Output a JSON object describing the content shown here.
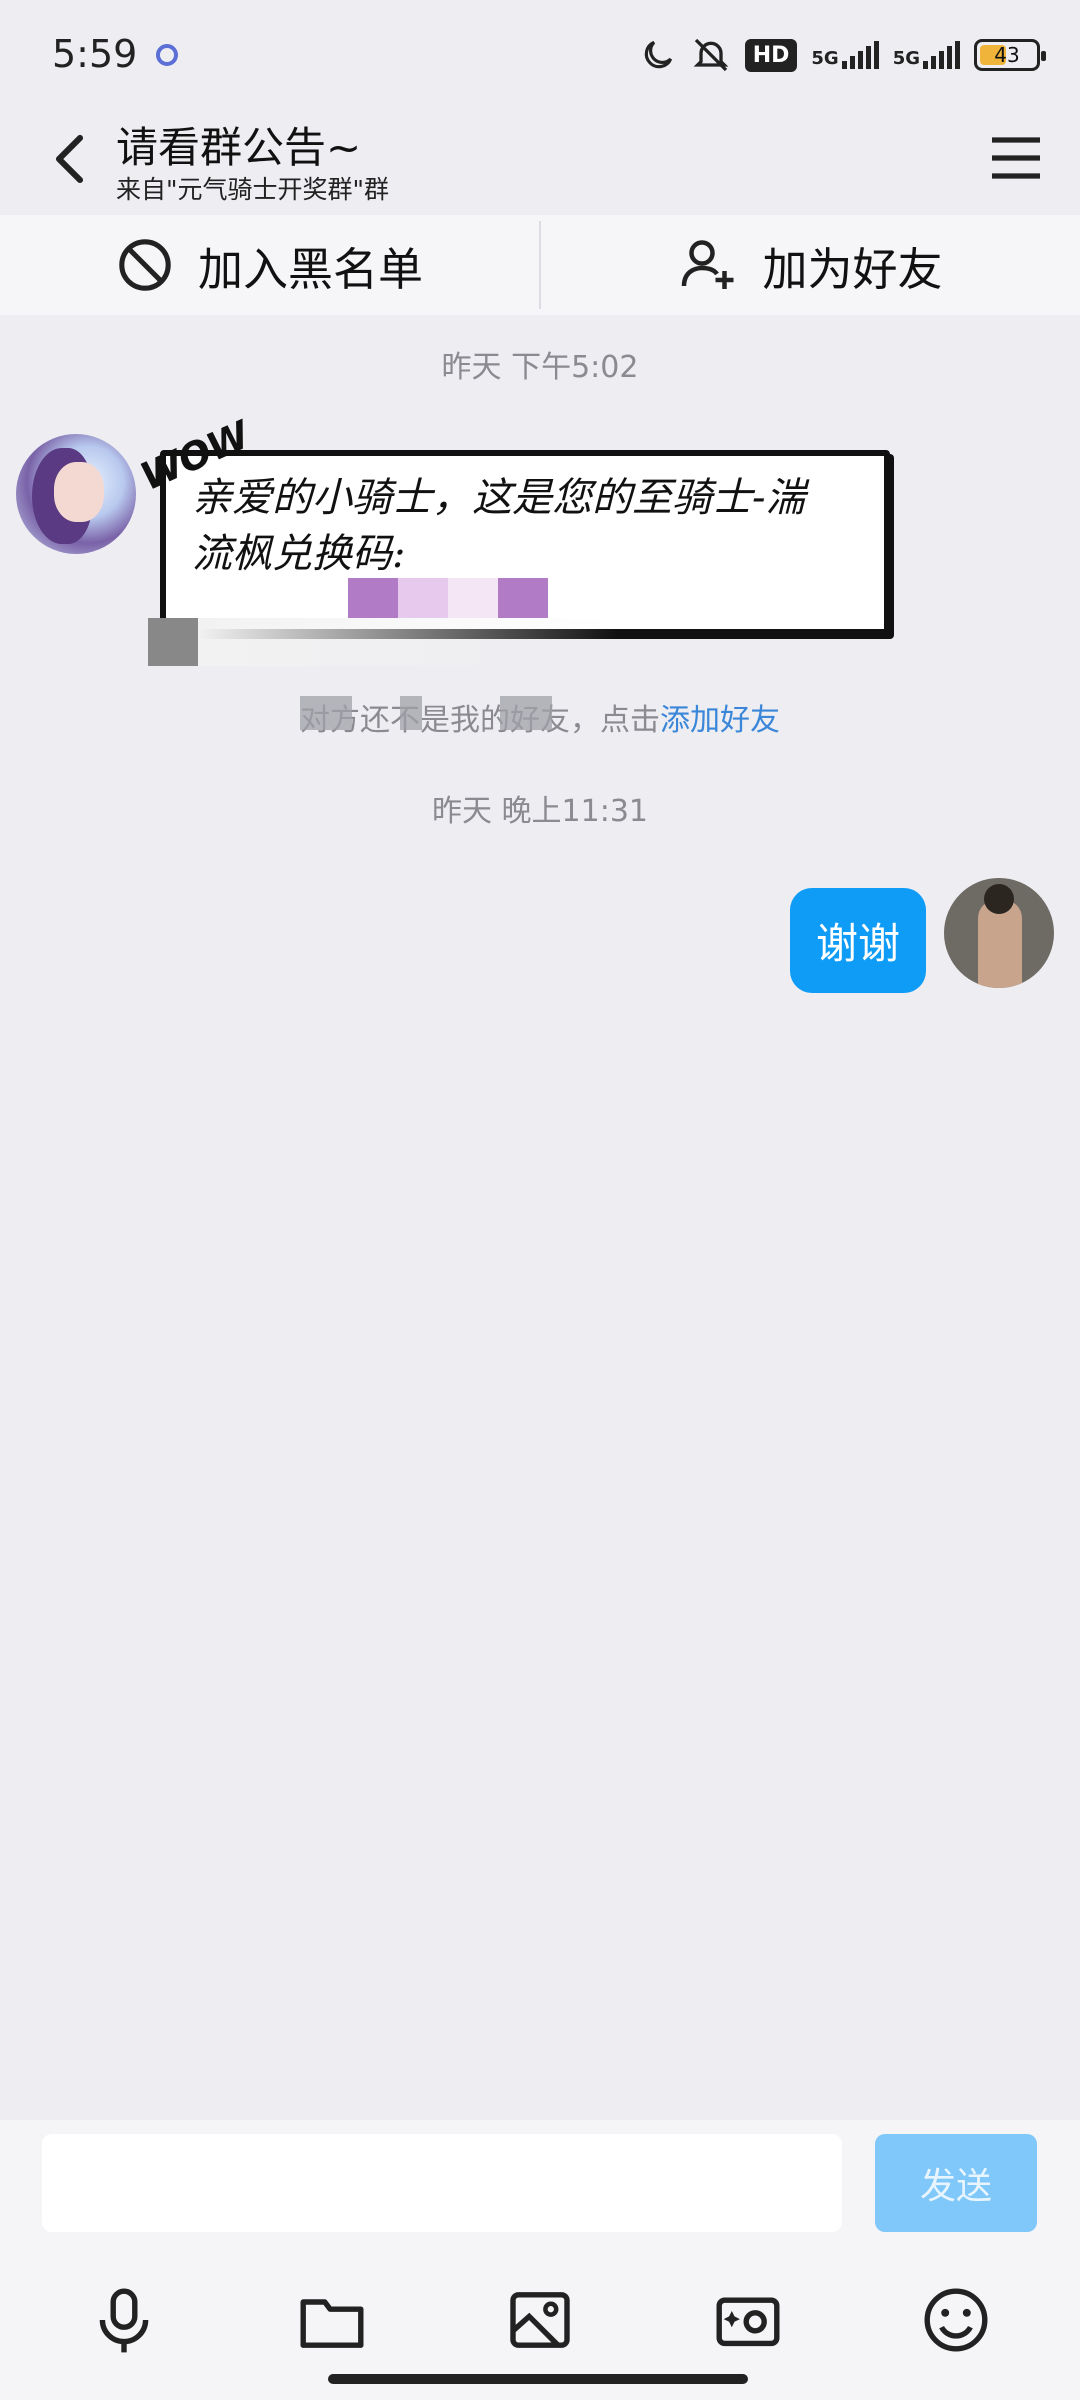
{
  "status": {
    "time": "5:59",
    "hd_label": "HD",
    "net1": "5G",
    "net2": "5G",
    "battery": "43"
  },
  "header": {
    "title": "请看群公告~",
    "subtitle": "来自\"元气骑士开奖群\"群"
  },
  "actions": {
    "blacklist_label": "加入黑名单",
    "add_friend_label": "加为好友"
  },
  "messages": {
    "ts1": "昨天 下午5:02",
    "sticker_wow": "WOW",
    "sticker_text": "亲爱的小骑士，这是您的至骑士-湍流枫兑换码:",
    "notice_prefix": "对方还不是我的好友，点击",
    "notice_link": "添加好友",
    "ts2": "昨天 晚上11:31",
    "reply": "谢谢"
  },
  "composer": {
    "input_value": "",
    "send_label": "发送"
  },
  "colors": {
    "accent": "#0e9cf7",
    "send_disabled": "#7fc8f9",
    "link": "#3a86d8",
    "background": "#ededf2"
  },
  "icons": {
    "back": "chevron-left-icon",
    "menu": "hamburger-menu-icon",
    "block": "block-icon",
    "add_user": "add-user-icon",
    "voice": "microphone-icon",
    "folder": "folder-icon",
    "image": "image-icon",
    "camera": "camera-icon",
    "emoji": "emoji-icon"
  }
}
